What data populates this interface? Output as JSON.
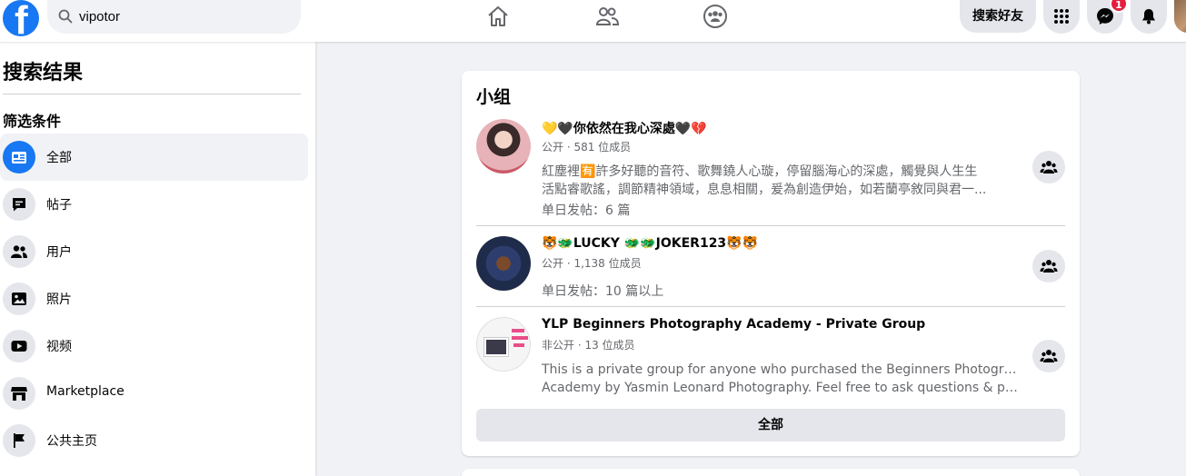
{
  "header": {
    "logo_letter": "f",
    "search_value": "vipotor",
    "find_friends_label": "搜索好友",
    "notification_count": "1"
  },
  "sidebar": {
    "title": "搜索结果",
    "filters_title": "筛选条件",
    "items": [
      {
        "label": "全部",
        "icon": "all-results-icon"
      },
      {
        "label": "帖子",
        "icon": "posts-icon"
      },
      {
        "label": "用户",
        "icon": "people-icon"
      },
      {
        "label": "照片",
        "icon": "photos-icon"
      },
      {
        "label": "视频",
        "icon": "video-icon"
      },
      {
        "label": "Marketplace",
        "icon": "marketplace-icon"
      },
      {
        "label": "公共主页",
        "icon": "flag-icon"
      }
    ]
  },
  "groups_card": {
    "title": "小组",
    "groups": [
      {
        "name": "💛🖤你依然在我心深處🖤💔",
        "meta": "公开 · 581 位成员",
        "desc_line1": "紅塵裡🈶許多好聽的音符、歌舞鐃人心璇，停留腦海心的深處，觸覺與人生生",
        "desc_line2": "活點睿歌謠，調節精神領域，息息相關，爰為創造伊始，如若蘭亭敘同與君一...",
        "posts": "单日发帖：6 篇"
      },
      {
        "name": "🐯🐲LUCKY 🐲🐲JOKER123🐯🐯",
        "meta": "公开 · 1,138 位成员",
        "posts": "单日发帖：10 篇以上"
      },
      {
        "name": "YLP Beginners Photography Academy - Private Group",
        "meta": "非公开 · 13 位成员",
        "desc_line1": "This is a private group for anyone who purchased the Beginners Photography",
        "desc_line2": "Academy by Yasmin Leonard Photography. Feel free to ask questions & post..."
      }
    ],
    "see_all_label": "全部"
  },
  "colors": {
    "brand_blue": "#1877f2",
    "page_bg": "#f0f2f5",
    "button_gray": "#e4e6eb",
    "badge_red": "#e41e3f"
  }
}
